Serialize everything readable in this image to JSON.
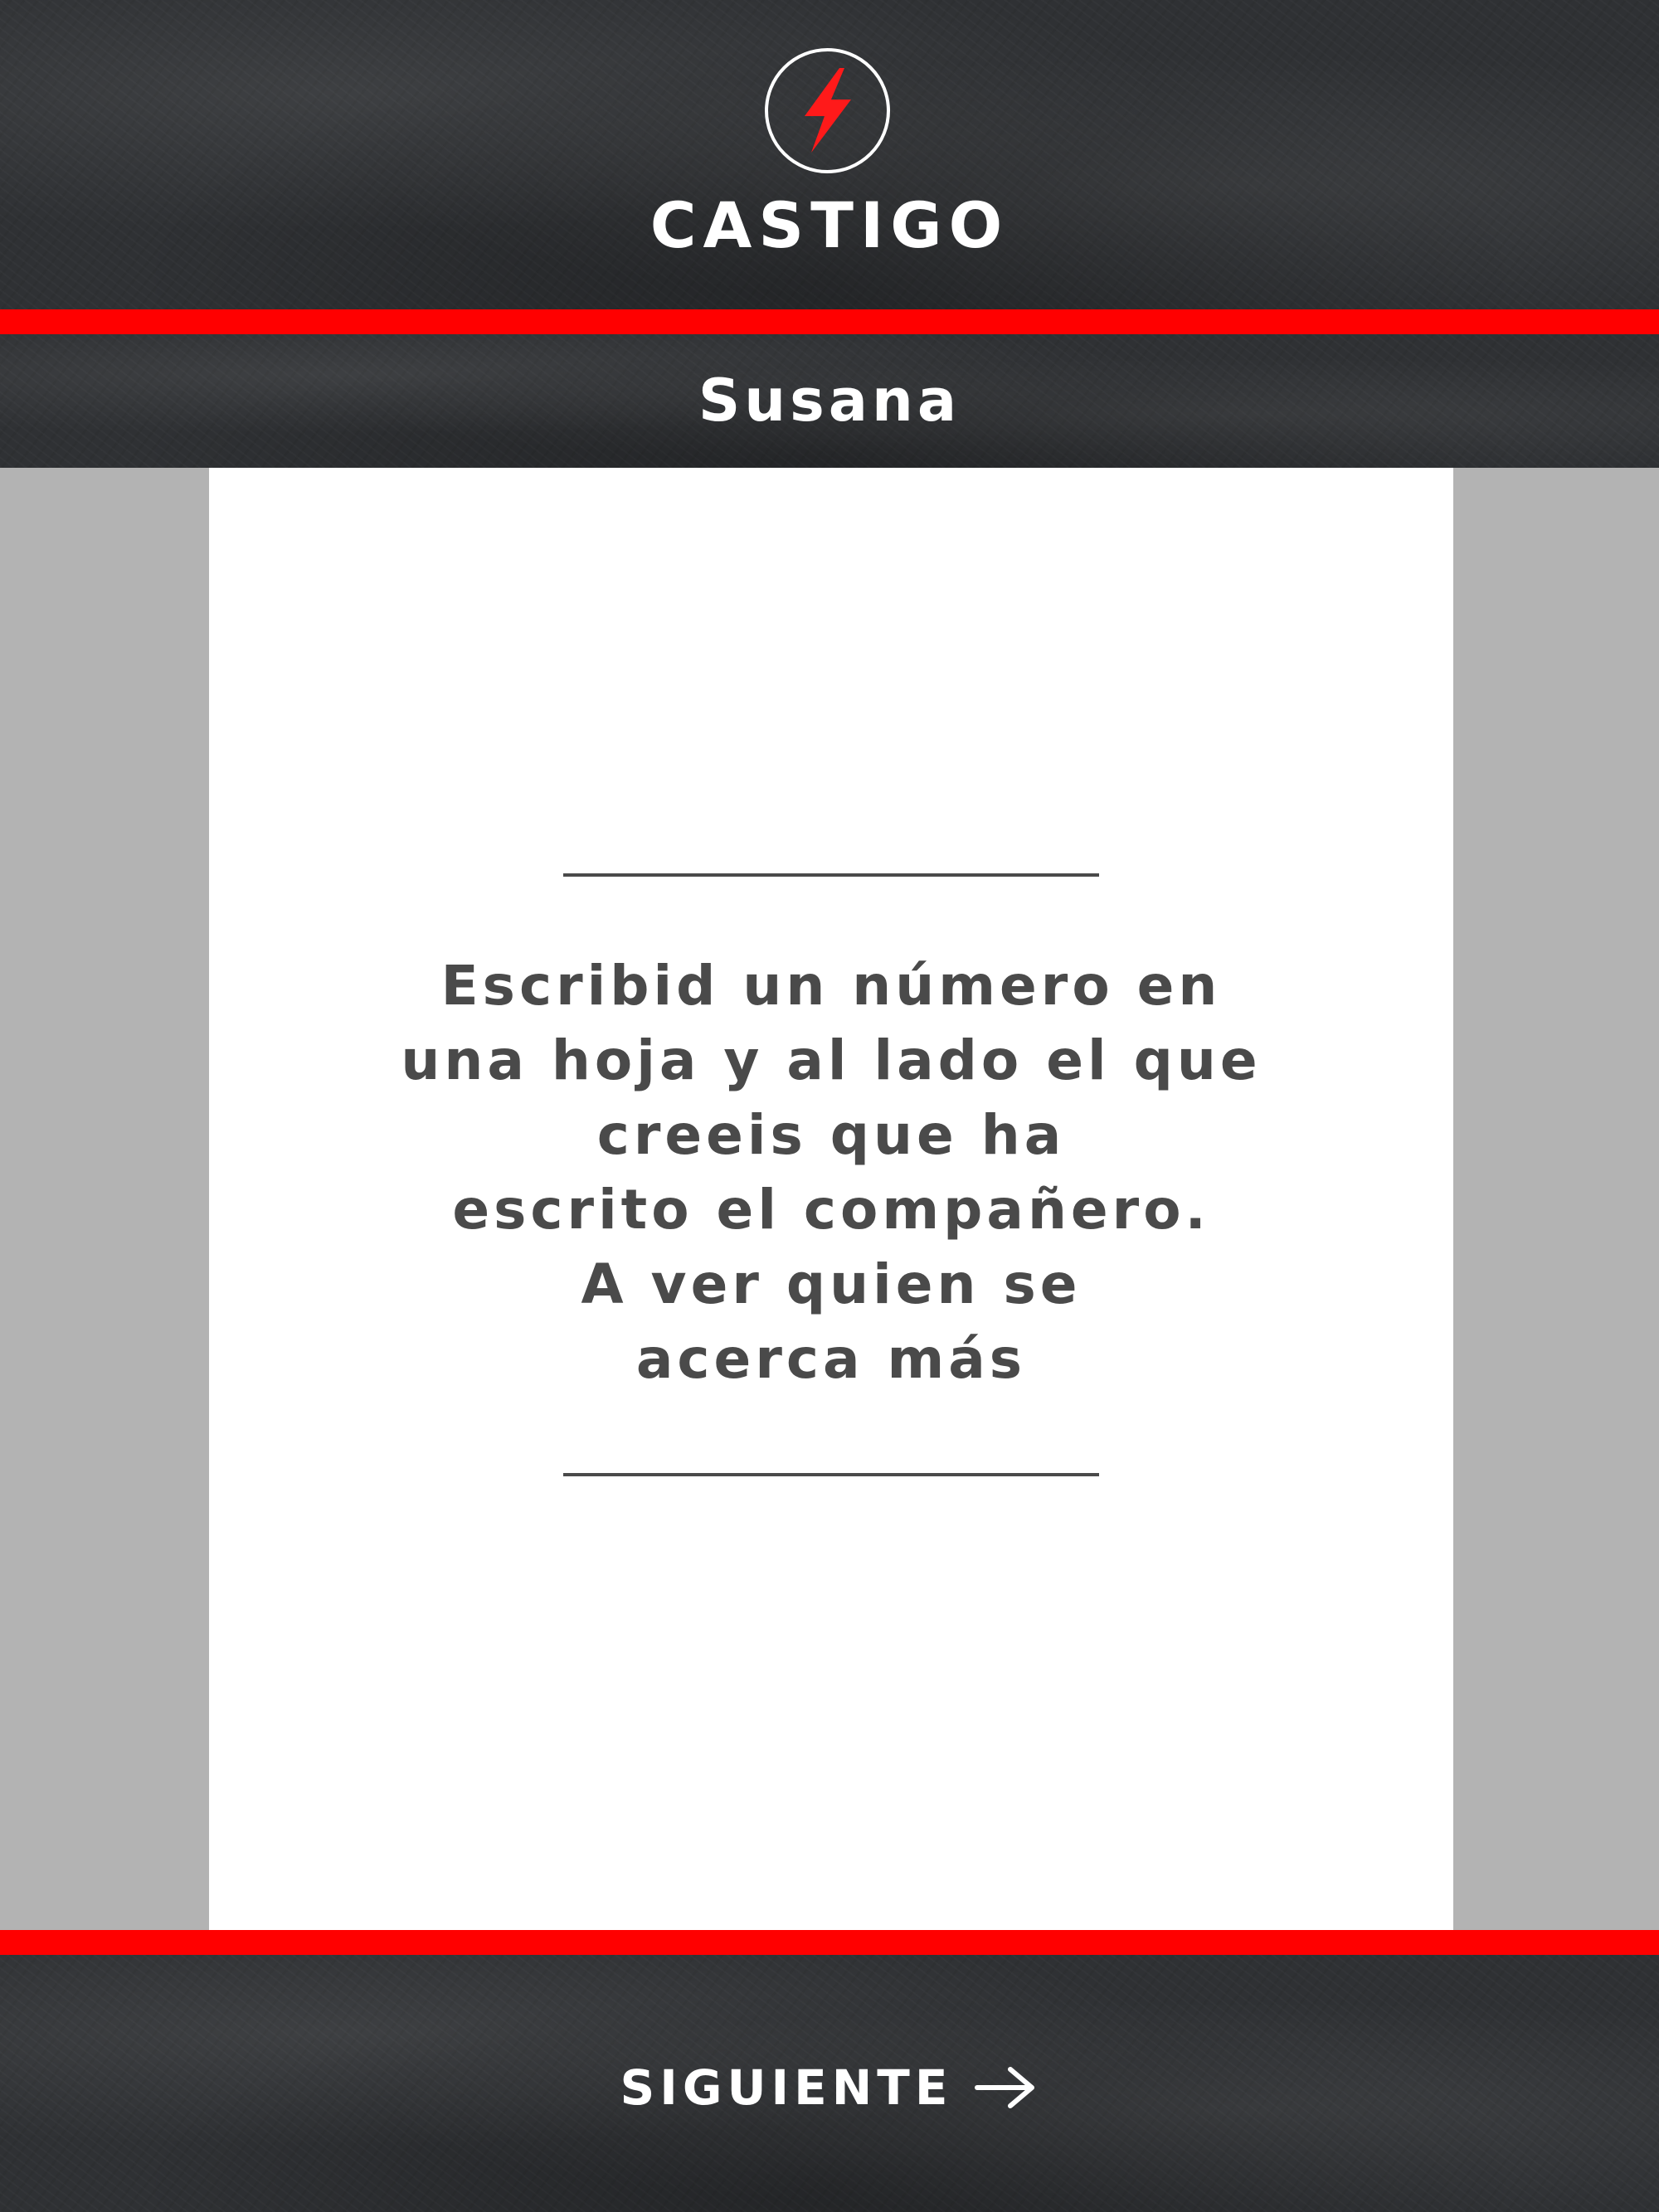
{
  "header": {
    "logo_icon": "lightning-bolt-icon",
    "title": "CASTIGO"
  },
  "player": {
    "name": "Susana"
  },
  "card": {
    "challenge_text": "Escribid un número en\nuna hoja y al lado el que\ncreeis que ha\nescrito el compañero.\nA ver quien se\nacerca más"
  },
  "footer": {
    "next_label": "SIGUIENTE",
    "next_icon": "arrow-right-icon"
  },
  "colors": {
    "accent": "#ff0000",
    "background": "#2f3134",
    "side_panels": "#b3b3b3",
    "card": "#ffffff",
    "card_text": "#4a4a4a"
  }
}
